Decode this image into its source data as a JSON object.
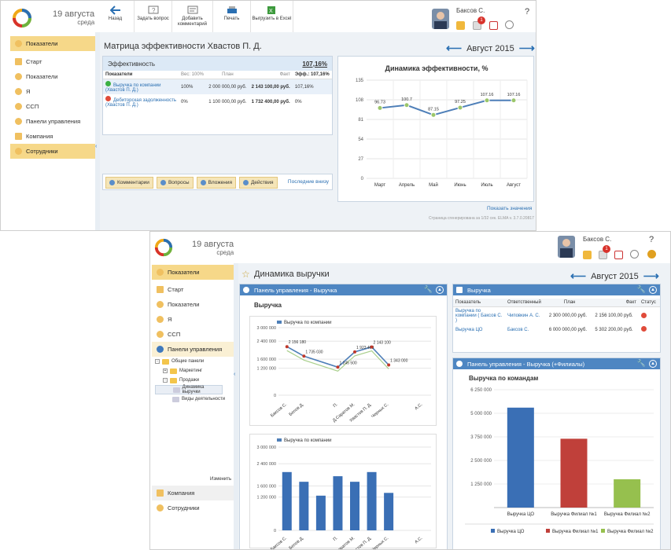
{
  "app": {
    "date": "19 августа",
    "weekday": "среда"
  },
  "toolbar": {
    "back": "Назад",
    "ask": "Задать вопрос",
    "comment": "Добавить комментарий",
    "print": "Печать",
    "excel": "Выгрузить в Excel"
  },
  "user": {
    "name": "Баксов С.",
    "notifications": "1",
    "help": "?"
  },
  "sidebar1": [
    {
      "label": "Показатели"
    },
    {
      "label": "Старт"
    },
    {
      "label": "Показатели"
    },
    {
      "label": "Я"
    },
    {
      "label": "ССП"
    },
    {
      "label": "Панели управления"
    },
    {
      "label": "Компания"
    },
    {
      "label": "Сотрудники"
    }
  ],
  "matrix": {
    "title": "Матрица эффективности Хвастов П. Д.",
    "month": "Август 2015",
    "eff_label": "Эффективность",
    "eff_value": "107,16%",
    "headers": {
      "ind": "Показатели",
      "weight": "Вес: 100%",
      "plan": "План",
      "fact": "Факт",
      "eff": "Эфф.: 107,16%"
    },
    "rows": [
      {
        "name": "Выручка по компании (Хвастов П. Д.)",
        "weight": "100%",
        "plan": "2 000 000,00 руб.",
        "fact": "2 143 100,00 руб.",
        "eff": "107,16%",
        "color": "#3cb043"
      },
      {
        "name": "Дебиторская задолженность (Хвастов П. Д.)",
        "weight": "0%",
        "plan": "1 100 000,00 руб.",
        "fact": "1 732 400,00 руб.",
        "eff": "0%",
        "color": "#e04b3a"
      }
    ],
    "buttons": {
      "comments": "Комментарии",
      "questions": "Вопросы",
      "attachments": "Вложения",
      "actions": "Действия"
    },
    "recent": "Последние внизу",
    "show_values": "Показать значения",
    "footer": "Страница сгенерирована за 1/32 сек. ELMA v. 3.7.0.20817"
  },
  "chart1_title": "Динамика эффективности, %",
  "chart_data": [
    {
      "type": "line",
      "title": "Динамика эффективности, %",
      "categories": [
        "Март",
        "Апрель",
        "Май",
        "Июнь",
        "Июль",
        "Август"
      ],
      "values": [
        96.73,
        100.7,
        87.15,
        97.25,
        107.16,
        107.16
      ],
      "ylim": [
        0,
        135
      ],
      "yticks": [
        0,
        27,
        54,
        81,
        108,
        135
      ]
    },
    {
      "type": "line",
      "title": "",
      "series": [
        {
          "name": "Выручка по компании",
          "values": [
            2156180,
            1735030,
            1245500,
            1923400,
            2143100,
            1343000
          ]
        }
      ],
      "categories": [
        "Баксов С.",
        "Белов Д.",
        "",
        "П.",
        "Д.Саратов М.",
        "Хвастов П. Д.",
        "Черных С.",
        "",
        "А.С."
      ],
      "ylim": [
        0,
        3000000
      ],
      "yticks": [
        "0",
        "1 200 000",
        "1 600 000",
        "2 400 000",
        "3 000 000"
      ]
    },
    {
      "type": "bar",
      "title": "",
      "series": [
        {
          "name": "Выручка по компании",
          "values": [
            2100000,
            1750000,
            1250000,
            1950000,
            1750000,
            2100000,
            1350000
          ]
        }
      ],
      "ylim": [
        0,
        3000000
      ],
      "yticks": [
        "0",
        "1 200 000",
        "1 600 000",
        "2 400 000",
        "3 000 000"
      ]
    },
    {
      "type": "bar",
      "title": "Выручка по командам",
      "categories": [
        "Выручка ЦО",
        "Выручка Филиал №1",
        "Выручка Филиал №2"
      ],
      "values": [
        5300000,
        3650000,
        1500000
      ],
      "ylim": [
        0,
        6250000
      ],
      "yticks": [
        "1 250 000",
        "2 500 000",
        "3 750 000",
        "5 000 000",
        "6 250 000"
      ]
    }
  ],
  "w2": {
    "date": "19 августа",
    "weekday": "среда",
    "user": "Баксов С.",
    "title": "Динамика выручки",
    "month": "Август 2015",
    "sidebar": [
      {
        "label": "Показатели"
      },
      {
        "label": "Старт"
      },
      {
        "label": "Показатели"
      },
      {
        "label": "Я"
      },
      {
        "label": "ССП"
      },
      {
        "label": "Панели управления"
      }
    ],
    "tree": {
      "root": "Общие панели",
      "marketing": "Маркетинг",
      "sales": "Продажи",
      "revenue": "Динамика выручки",
      "activity": "Виды деятельности"
    },
    "change": "Изменить",
    "bottom": [
      {
        "label": "Компания"
      },
      {
        "label": "Сотрудники"
      }
    ],
    "panel_left": "Панель управления - Выручка",
    "panel_left_sub": "Выручка",
    "line_labels": [
      "2 156 180",
      "1 735 030",
      "1 245 500",
      "1 923 400",
      "2 143 100",
      "1 343 000"
    ],
    "legend_line": "Выручка по компании",
    "legend_bar": "Выручка по компании",
    "panel_right_top": "Выручка",
    "rt_headers": {
      "ind": "Показатель",
      "resp": "Ответственный",
      "plan": "План",
      "fact": "Факт",
      "status": "Статус"
    },
    "rt_rows": [
      {
        "name": "Выручка по компании ( Баксов С. )",
        "resp": "Чиповкин А. С.",
        "plan": "2 300 000,00 руб.",
        "fact": "2 156 100,00 руб."
      },
      {
        "name": "Выручка ЦО",
        "resp": "Баксов С.",
        "plan": "6 000 000,00 руб.",
        "fact": "5 302 200,00 руб."
      }
    ],
    "panel_right_bottom": "Панель управления - Выручка (+Филиалы)",
    "bar_title": "Выручка по командам",
    "legend_teams": [
      "Выручка ЦО",
      "Выручка Филиал №1",
      "Выручка Филиал №2"
    ]
  }
}
